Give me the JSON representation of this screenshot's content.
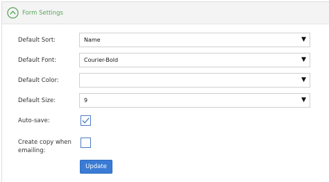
{
  "header": {
    "title": "Form Settings",
    "collapse_icon": "chevron-up-circle-icon",
    "accent_color": "#58a55c"
  },
  "fields": {
    "default_sort": {
      "label": "Default Sort:",
      "value": "Name"
    },
    "default_font": {
      "label": "Default Font:",
      "value": "Courier-Bold"
    },
    "default_color": {
      "label": "Default Color:",
      "value": ""
    },
    "default_size": {
      "label": "Default Size:",
      "value": "9"
    },
    "auto_save": {
      "label": "Auto-save:",
      "checked": true
    },
    "create_copy": {
      "label_line1": "Create copy when",
      "label_line2": "emailing:",
      "checked": false
    }
  },
  "dropdown_arrow": "▼",
  "update_button": {
    "label": "Update",
    "color": "#3a7bd5"
  }
}
